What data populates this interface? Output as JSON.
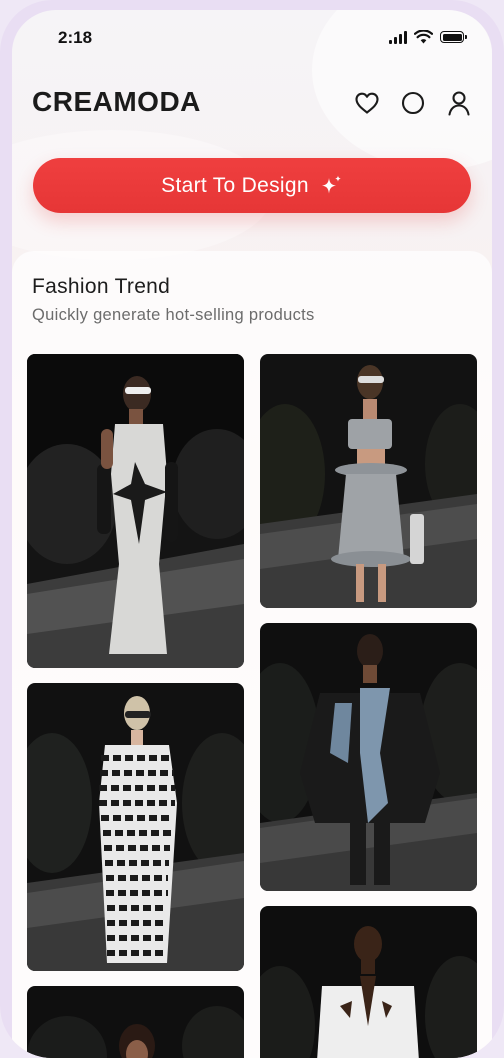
{
  "status_bar": {
    "time": "2:18",
    "icons": [
      "signal-icon",
      "wifi-icon",
      "battery-icon"
    ]
  },
  "header": {
    "logo": "CREAMODA",
    "icons": [
      "heart-icon",
      "circle-icon",
      "user-icon"
    ]
  },
  "cta": {
    "label": "Start To Design",
    "icon": "sparkle-icon",
    "color": "#E63A3A"
  },
  "section": {
    "title": "Fashion Trend",
    "subtitle": "Quickly generate hot-selling products"
  },
  "gallery": [
    {
      "name": "runway-look-white-gown",
      "outfit": "white gown with black star panel and long black gloves"
    },
    {
      "name": "runway-look-grey-knit-set",
      "outfit": "grey knit bandeau top and hoop skirt"
    },
    {
      "name": "runway-look-black-denim-jacket",
      "outfit": "black oversized jacket with denim panels"
    },
    {
      "name": "runway-look-zigzag-dress",
      "outfit": "black and white zigzag striped dress"
    },
    {
      "name": "runway-look-white-blazer",
      "outfit": "white cut-out blazer"
    },
    {
      "name": "runway-look-partial",
      "outfit": "model with dark hair"
    }
  ]
}
